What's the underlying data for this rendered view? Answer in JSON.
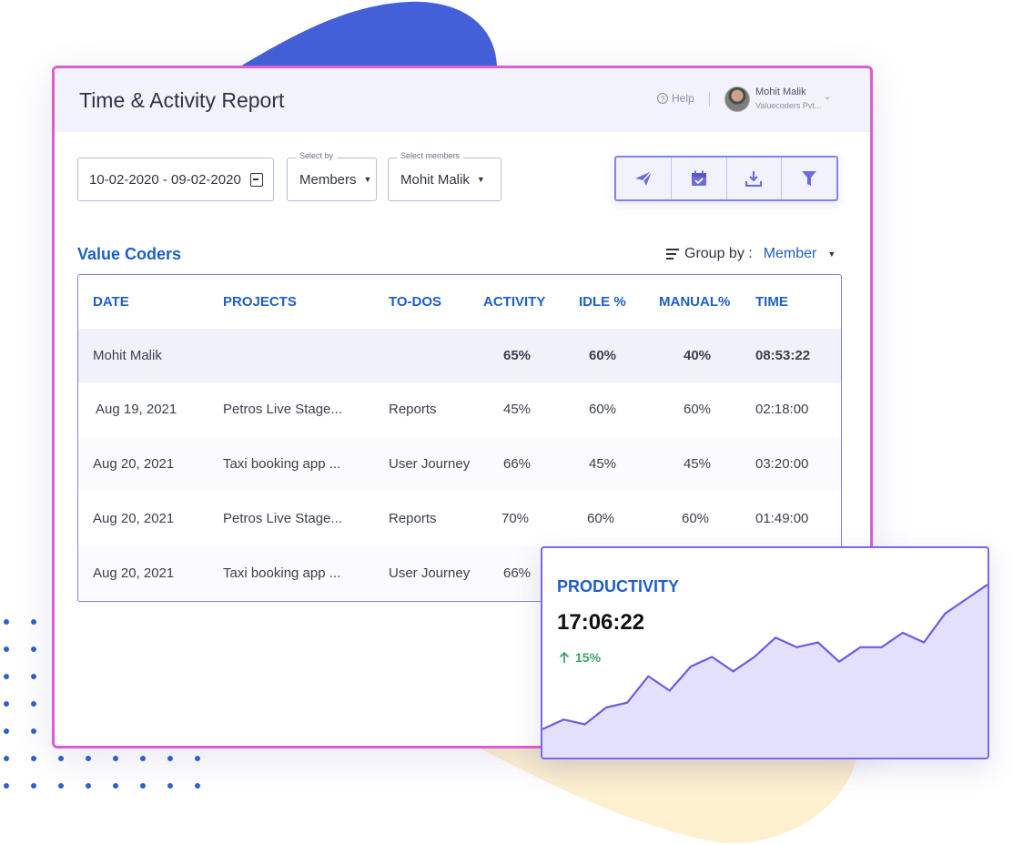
{
  "header": {
    "title": "Time & Activity Report",
    "help_label": "Help",
    "user": {
      "name": "Mohit Malik",
      "company": "Valuecoders Pvt..."
    }
  },
  "filters": {
    "date_range": "10-02-2020 - 09-02-2020",
    "select_by": {
      "label": "Select by",
      "value": "Members"
    },
    "select_members": {
      "label": "Select members",
      "value": "Mohit Malik"
    }
  },
  "toolbar": {
    "icons": [
      "send-icon",
      "calendar-icon",
      "download-icon",
      "filter-icon"
    ],
    "accent": "#6c6cde"
  },
  "section": {
    "title": "Value Coders",
    "group_by_label": "Group by :",
    "group_by_value": "Member"
  },
  "table": {
    "columns": [
      "DATE",
      "PROJECTS",
      "TO-DOS",
      "ACTIVITY",
      "IDLE %",
      "MANUAL%",
      "TIME"
    ],
    "summary": {
      "name": "Mohit Malik",
      "activity": "65%",
      "idle": "60%",
      "manual": "40%",
      "time": "08:53:22"
    },
    "rows": [
      {
        "date": "Aug 19, 2021",
        "project": "Petros Live Stage...",
        "todo": "Reports",
        "activity": "45%",
        "idle": "60%",
        "manual": "60%",
        "time": "02:18:00"
      },
      {
        "date": "Aug 20, 2021",
        "project": "Taxi booking app ...",
        "todo": "User Journey",
        "activity": "66%",
        "idle": "45%",
        "manual": "45%",
        "time": "03:20:00"
      },
      {
        "date": "Aug 20, 2021",
        "project": "Petros Live Stage...",
        "todo": "Reports",
        "activity": "70%",
        "idle": "60%",
        "manual": "60%",
        "time": "01:49:00"
      },
      {
        "date": "Aug 20, 2021",
        "project": "Taxi booking app ...",
        "todo": "User Journey",
        "activity": "66%",
        "idle": "",
        "manual": "",
        "time": ""
      }
    ]
  },
  "productivity": {
    "title": "PRODUCTIVITY",
    "value": "17:06:22",
    "change": "15%",
    "trend_color": "#3aa66b",
    "series": [
      8,
      12,
      10,
      17,
      19,
      30,
      24,
      34,
      38,
      32,
      38,
      46,
      42,
      44,
      36,
      42,
      42,
      48,
      44,
      56,
      62,
      68
    ]
  },
  "colors": {
    "brand_blue": "#1f5fc4",
    "panel_border": "#d95fd2",
    "chart_line": "#6f5ce0",
    "chart_fill": "#e3e0fb"
  }
}
